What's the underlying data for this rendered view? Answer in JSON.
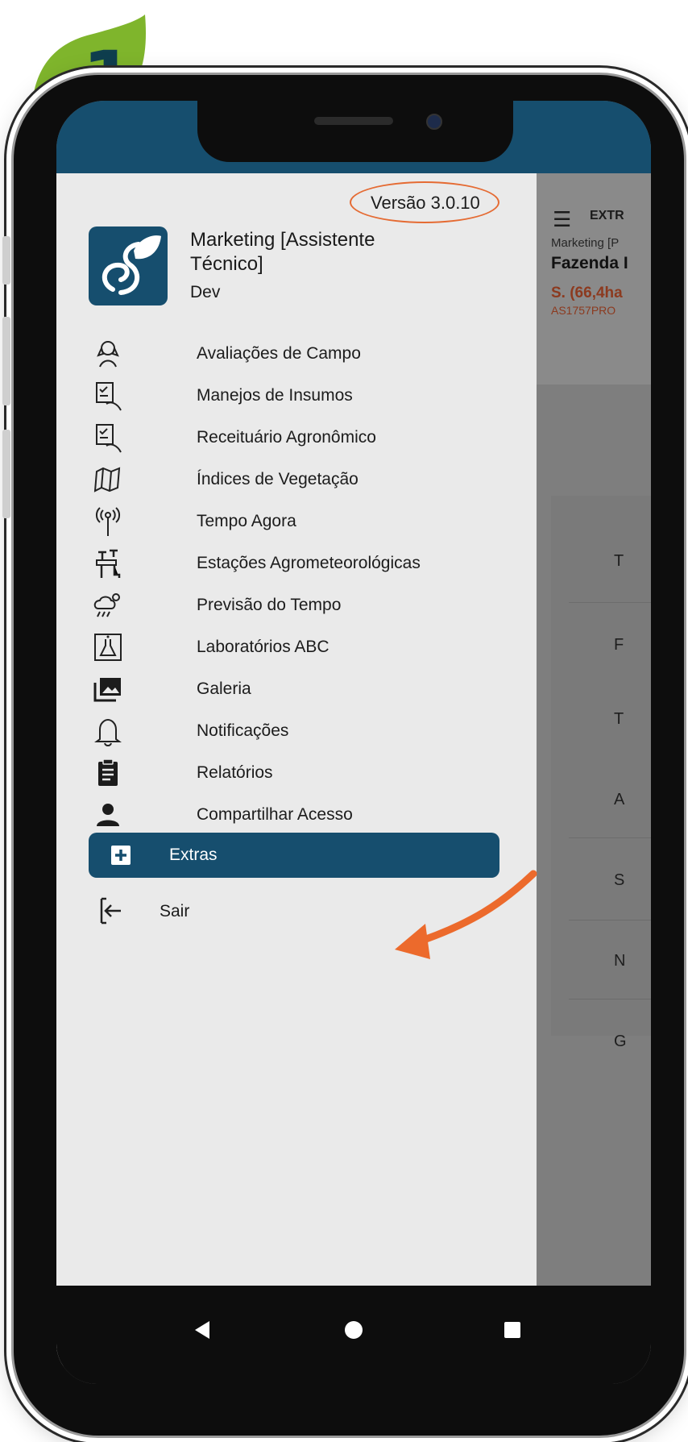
{
  "step_badge": {
    "number": "1",
    "color": "#7fb52c"
  },
  "drawer": {
    "version": "Versão 3.0.10",
    "user": {
      "name": "Marketing [Assistente Técnico]",
      "role": "Dev"
    },
    "menu": [
      {
        "label": "Avaliações de Campo",
        "icon": "field-evaluation-icon"
      },
      {
        "label": "Manejos de Insumos",
        "icon": "checklist-hand-icon"
      },
      {
        "label": "Receituário Agronômico",
        "icon": "prescription-hand-icon"
      },
      {
        "label": "Índices de Vegetação",
        "icon": "vegetation-map-icon"
      },
      {
        "label": "Tempo Agora",
        "icon": "antenna-icon"
      },
      {
        "label": "Estações Agrometeorológicas",
        "icon": "weather-station-icon"
      },
      {
        "label": "Previsão do Tempo",
        "icon": "rain-sun-cloud-icon"
      },
      {
        "label": "Laboratórios ABC",
        "icon": "lab-flask-icon"
      },
      {
        "label": "Galeria",
        "icon": "gallery-icon"
      },
      {
        "label": "Notificações",
        "icon": "bell-icon"
      },
      {
        "label": "Relatórios",
        "icon": "clipboard-icon"
      },
      {
        "label": "Compartilhar Acesso",
        "icon": "person-icon"
      },
      {
        "label": "Extras",
        "icon": "plus-box-icon",
        "active": true
      }
    ],
    "logout": {
      "label": "Sair",
      "icon": "logout-icon"
    }
  },
  "background_app": {
    "title": "EXTR",
    "subtitle": "Marketing [P",
    "farm": "Fazenda I",
    "area": "S. (66,4ha",
    "code": "AS1757PRO",
    "rows": [
      "T",
      "F",
      "T",
      "A",
      "S",
      "N",
      "G"
    ]
  },
  "colors": {
    "primary": "#164e6e",
    "annotation": "#e56b33",
    "drawer_bg": "#eaeaea"
  }
}
